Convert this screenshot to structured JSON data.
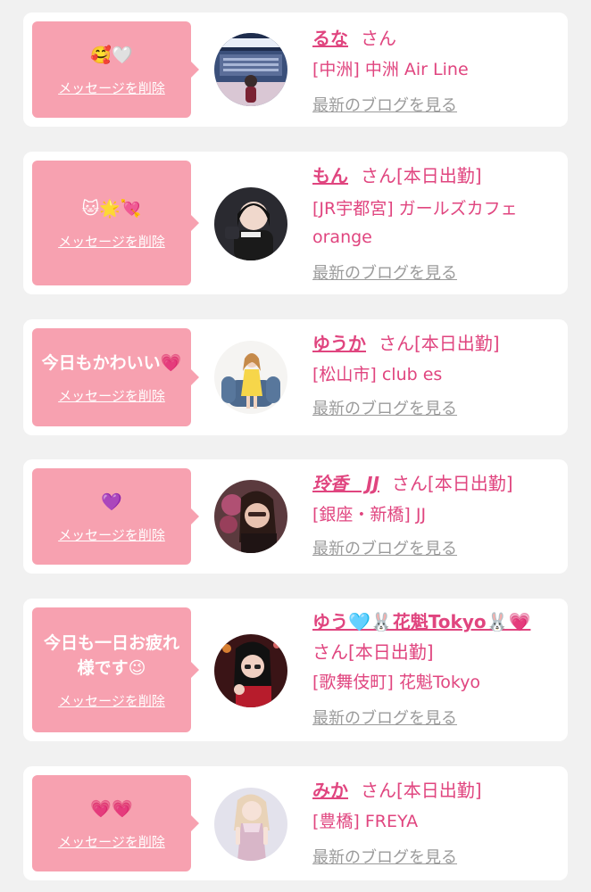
{
  "cards": [
    {
      "message": "🥰🤍",
      "delete_label": "メッセージを削除",
      "name": "るな",
      "san": "さん",
      "attendance": "",
      "shop": "[中洲] 中洲 Air Line",
      "blog_label": "最新のブログを見る",
      "avatar_desc": "Air Line sign background"
    },
    {
      "message": "🐱🌟💘",
      "delete_label": "メッセージを削除",
      "name": "もん",
      "san": "さん",
      "attendance": "[本日出勤]",
      "shop": "[JR宇都宮] ガールズカフェ orange",
      "blog_label": "最新のブログを見る"
    },
    {
      "message": "今日もかわいい💗",
      "delete_label": "メッセージを削除",
      "name": "ゆうか",
      "san": "さん",
      "attendance": "[本日出勤]",
      "shop": "[松山市] club es",
      "blog_label": "最新のブログを見る"
    },
    {
      "message": "💜",
      "delete_label": "メッセージを削除",
      "name": "玲香　JJ",
      "san": "さん",
      "attendance": "[本日出勤]",
      "shop": "[銀座・新橋] JJ",
      "blog_label": "最新のブログを見る"
    },
    {
      "message": "今日も一日お疲れ様です😉",
      "delete_label": "メッセージを削除",
      "name": "ゆう🩵🐰花魁Tokyo🐰💗",
      "san": "さん",
      "attendance": "[本日出勤]",
      "shop": "[歌舞伎町] 花魁Tokyo",
      "blog_label": "最新のブログを見る"
    },
    {
      "message": "💗💗",
      "delete_label": "メッセージを削除",
      "name": "みか",
      "san": "さん",
      "attendance": "[本日出勤]",
      "shop": "[豊橋] FREYA",
      "blog_label": "最新のブログを見る"
    }
  ],
  "colors": {
    "accent": "#e0457f",
    "bubble": "#f7a1b0",
    "link_gray": "#9b9b9b",
    "background": "#f1f1f1"
  }
}
